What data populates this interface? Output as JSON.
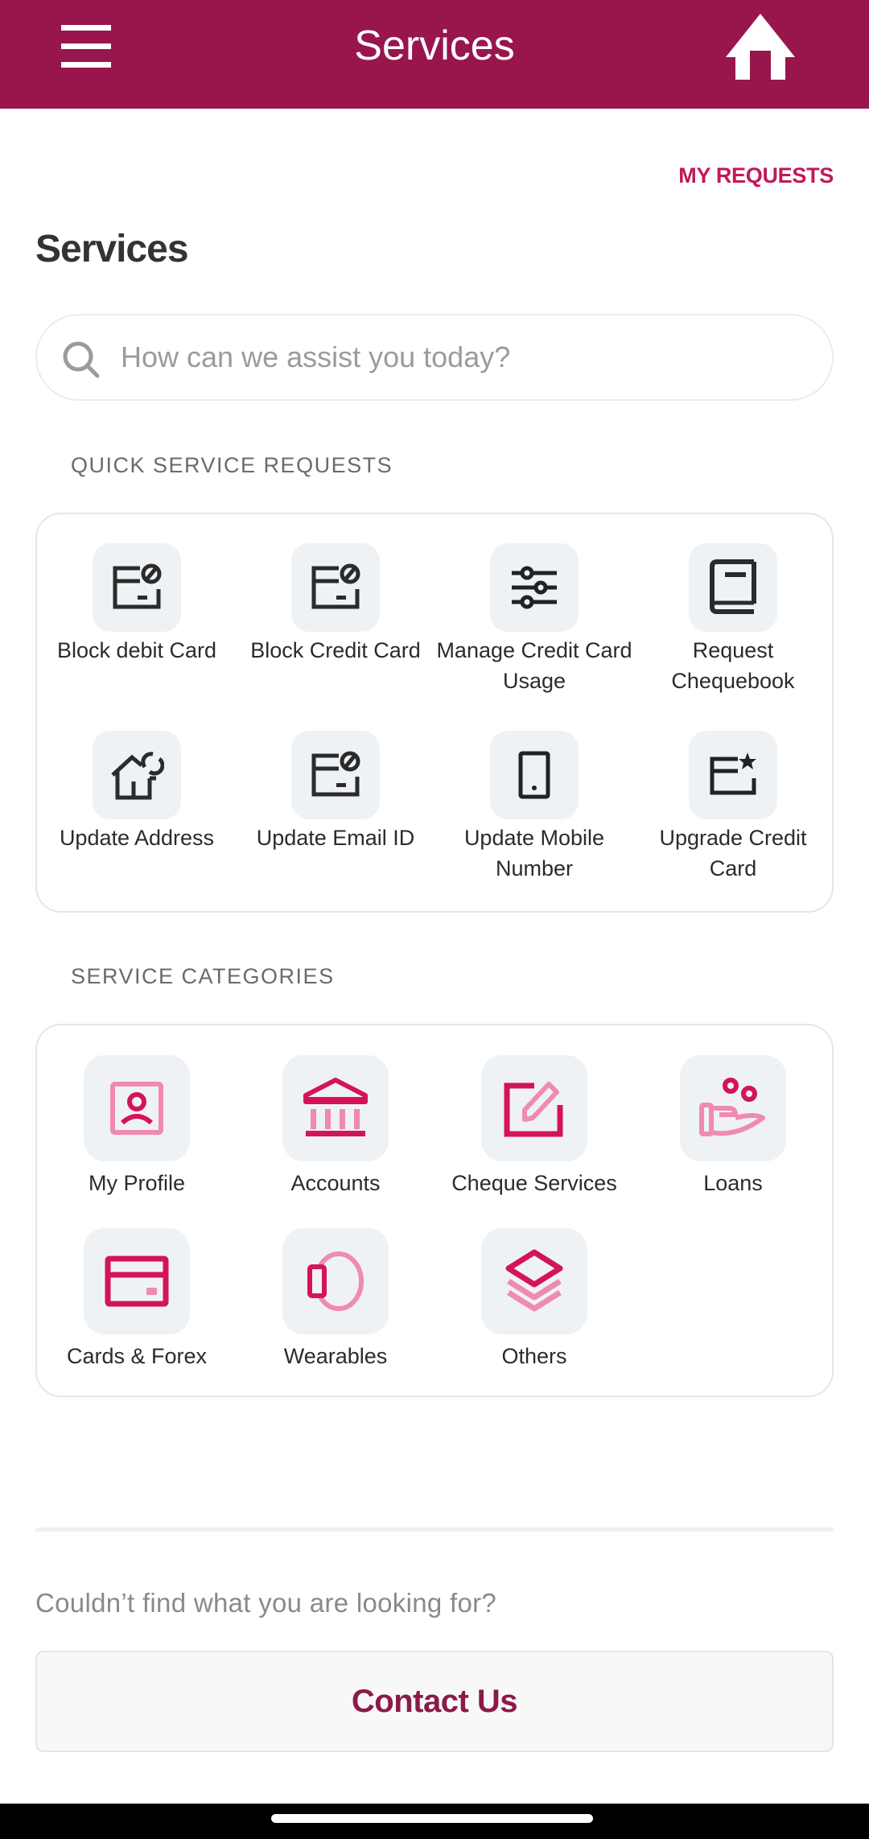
{
  "header": {
    "title": "Services",
    "menu_icon": "hamburger-menu-icon",
    "home_icon": "home-icon",
    "background_color": "#98164c"
  },
  "my_requests_label": "MY REQUESTS",
  "page_title": "Services",
  "search": {
    "placeholder": "How can we assist you today?",
    "value": "",
    "icon": "search-icon"
  },
  "quick_service": {
    "heading": "QUICK SERVICE REQUESTS",
    "items": [
      {
        "label": "Block debit Card",
        "icon": "card-block-icon"
      },
      {
        "label": "Block Credit Card",
        "icon": "card-block-icon"
      },
      {
        "label": "Manage Credit Card Usage",
        "icon": "sliders-icon"
      },
      {
        "label": "Request Chequebook",
        "icon": "book-icon"
      },
      {
        "label": "Update Address",
        "icon": "home-refresh-icon"
      },
      {
        "label": "Update Email ID",
        "icon": "card-block-icon"
      },
      {
        "label": "Update Mobile Number",
        "icon": "mobile-phone-icon"
      },
      {
        "label": "Upgrade Credit Card",
        "icon": "card-star-icon"
      }
    ]
  },
  "service_categories": {
    "heading": "SERVICE CATEGORIES",
    "items": [
      {
        "label": "My Profile",
        "icon": "profile-icon"
      },
      {
        "label": "Accounts",
        "icon": "bank-icon"
      },
      {
        "label": "Cheque Services",
        "icon": "edit-icon"
      },
      {
        "label": "Loans",
        "icon": "hand-coins-icon"
      },
      {
        "label": "Cards & Forex",
        "icon": "credit-card-icon"
      },
      {
        "label": "Wearables",
        "icon": "wearable-ring-icon"
      },
      {
        "label": "Others",
        "icon": "layers-icon"
      }
    ]
  },
  "footer": {
    "prompt": "Couldn’t find what you are looking for?",
    "contact_label": "Contact Us"
  },
  "colors": {
    "accent": "#c2185b",
    "accent_dark": "#d4145a",
    "accent_light": "#ef8bb0",
    "contact_text": "#8b1a4a",
    "icon_dark": "#1f2227",
    "tile_bg": "#eff2f5"
  }
}
